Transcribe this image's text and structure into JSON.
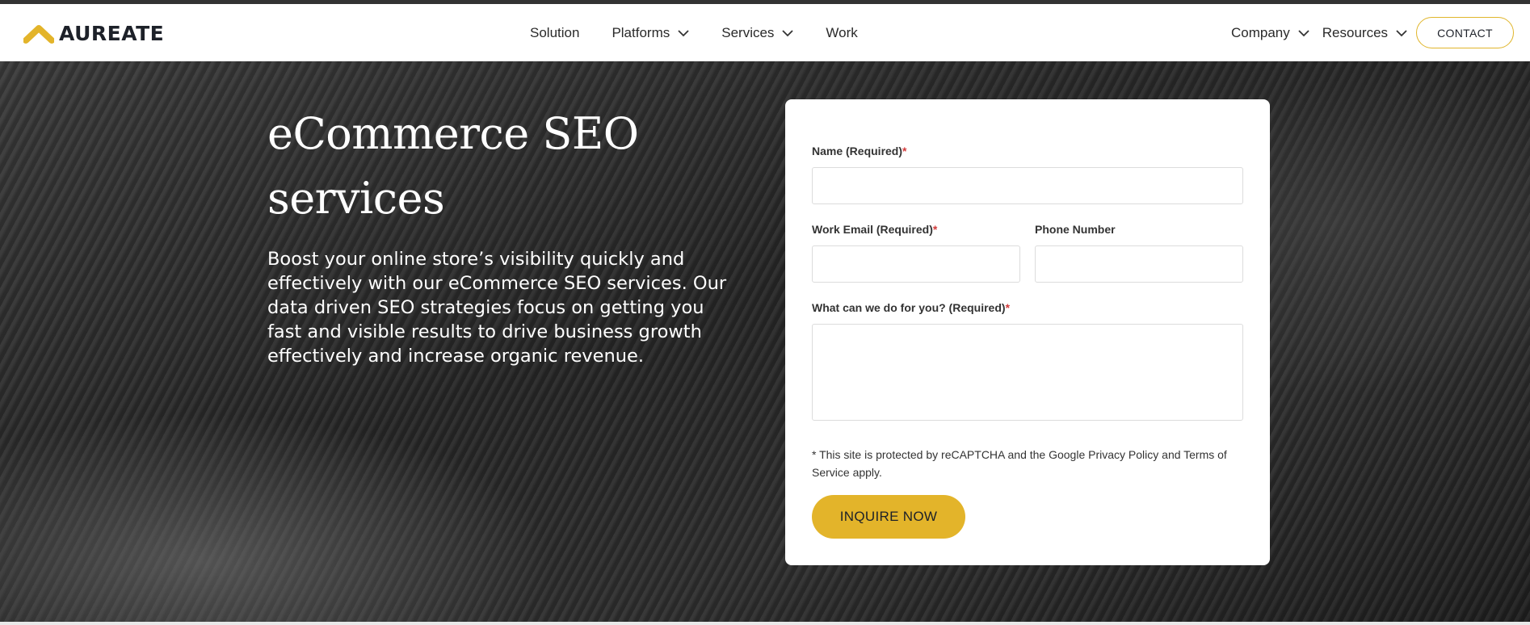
{
  "brand": {
    "name": "AUREATE",
    "accent": "#e3b42a",
    "icon": "chevron-up-logo-icon"
  },
  "nav": {
    "center": [
      {
        "label": "Solution",
        "dropdown": false
      },
      {
        "label": "Platforms",
        "dropdown": true
      },
      {
        "label": "Services",
        "dropdown": true
      },
      {
        "label": "Work",
        "dropdown": false
      }
    ],
    "right": [
      {
        "label": "Company",
        "dropdown": true
      },
      {
        "label": "Resources",
        "dropdown": true
      }
    ],
    "contact_label": "CONTACT"
  },
  "hero": {
    "title_line1": "eCommerce SEO",
    "title_line2": "services",
    "description": "Boost your online store’s visibility quickly and effectively with our eCommerce SEO services. Our data driven SEO strategies focus on getting you fast and visible results to drive business growth effectively and increase organic revenue."
  },
  "form": {
    "name_label": "Name (Required)",
    "email_label": "Work Email (Required)",
    "phone_label": "Phone Number",
    "message_label": "What can we do for you? (Required)",
    "required_marker": "*",
    "name_value": "",
    "email_value": "",
    "phone_value": "",
    "message_value": "",
    "notice": "* This site is protected by reCAPTCHA and the Google Privacy Policy and Terms of Service apply.",
    "submit_label": "INQUIRE NOW"
  }
}
